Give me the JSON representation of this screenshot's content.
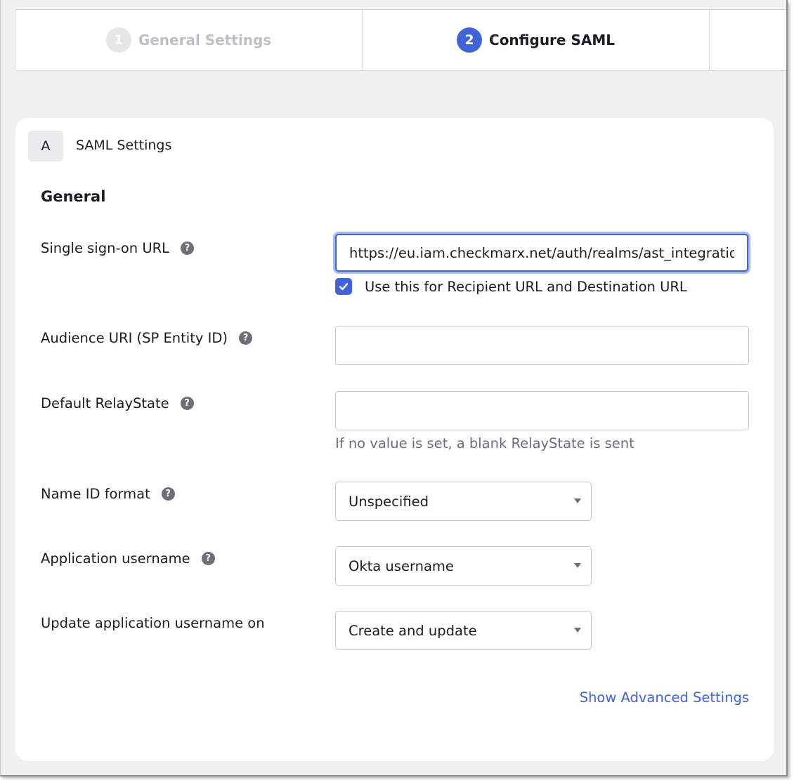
{
  "stepper": {
    "steps": [
      {
        "number": "1",
        "label": "General Settings",
        "state": "inactive"
      },
      {
        "number": "2",
        "label": "Configure SAML",
        "state": "active"
      }
    ]
  },
  "section": {
    "badge": "A",
    "title": "SAML Settings",
    "group_title": "General"
  },
  "fields": {
    "sso_url": {
      "label": "Single sign-on URL",
      "value": "https://eu.iam.checkmarx.net/auth/realms/ast_integration",
      "checkbox_label": "Use this for Recipient URL and Destination URL",
      "checkbox_checked": true
    },
    "audience_uri": {
      "label": "Audience URI (SP Entity ID)",
      "value": ""
    },
    "relay_state": {
      "label": "Default RelayState",
      "value": "",
      "hint": "If no value is set, a blank RelayState is sent"
    },
    "name_id_format": {
      "label": "Name ID format",
      "selected": "Unspecified"
    },
    "app_username": {
      "label": "Application username",
      "selected": "Okta username"
    },
    "update_username_on": {
      "label": "Update application username on",
      "selected": "Create and update"
    }
  },
  "links": {
    "advanced": "Show Advanced Settings"
  },
  "colors": {
    "accent": "#4064d8",
    "help_icon": "#6e6e78"
  },
  "icons": {
    "help": "?"
  }
}
